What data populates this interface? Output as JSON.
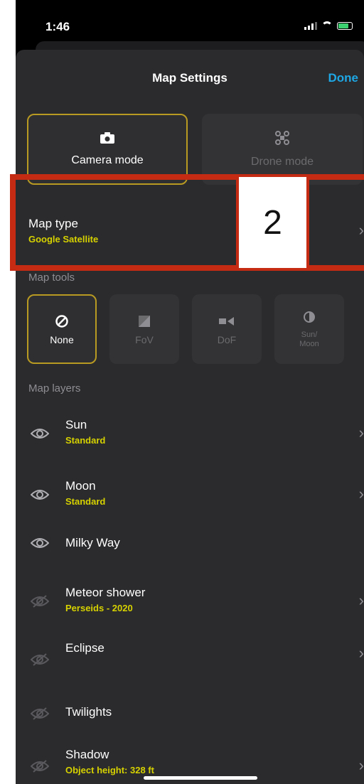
{
  "status_bar": {
    "time": "1:46"
  },
  "nav": {
    "title": "Map Settings",
    "done_label": "Done"
  },
  "modes": [
    {
      "label": "Camera mode",
      "icon": "camera-icon",
      "active": true
    },
    {
      "label": "Drone mode",
      "icon": "drone-icon",
      "active": false
    }
  ],
  "map_type": {
    "title": "Map type",
    "value": "Google Satellite"
  },
  "map_tools": {
    "header": "Map tools",
    "items": [
      {
        "label": "None",
        "icon": "none-icon",
        "active": true
      },
      {
        "label": "FoV",
        "icon": "fov-icon",
        "active": false
      },
      {
        "label": "DoF",
        "icon": "dof-icon",
        "active": false
      },
      {
        "label": "Sun/\nMoon",
        "icon": "sun-moon-icon",
        "active": false
      }
    ]
  },
  "map_layers": {
    "header": "Map layers",
    "items": [
      {
        "title": "Sun",
        "sub": "Standard",
        "visible": true,
        "chevron": true
      },
      {
        "title": "Moon",
        "sub": "Standard",
        "visible": true,
        "chevron": true
      },
      {
        "title": "Milky Way",
        "sub": "",
        "visible": true,
        "chevron": false
      },
      {
        "title": "Meteor shower",
        "sub": "Perseids - 2020",
        "visible": false,
        "chevron": true
      },
      {
        "title": "Eclipse",
        "sub": "",
        "visible": false,
        "chevron": true
      },
      {
        "title": "Twilights",
        "sub": "",
        "visible": false,
        "chevron": false
      },
      {
        "title": "Shadow",
        "sub": "Object height: 328 ft",
        "visible": false,
        "chevron": true
      }
    ]
  },
  "annotation": {
    "label": "2"
  },
  "colors": {
    "accent": "#d6d100",
    "done": "#1ea7e4",
    "annotation": "#c52a12",
    "active_border": "#b89a22"
  }
}
